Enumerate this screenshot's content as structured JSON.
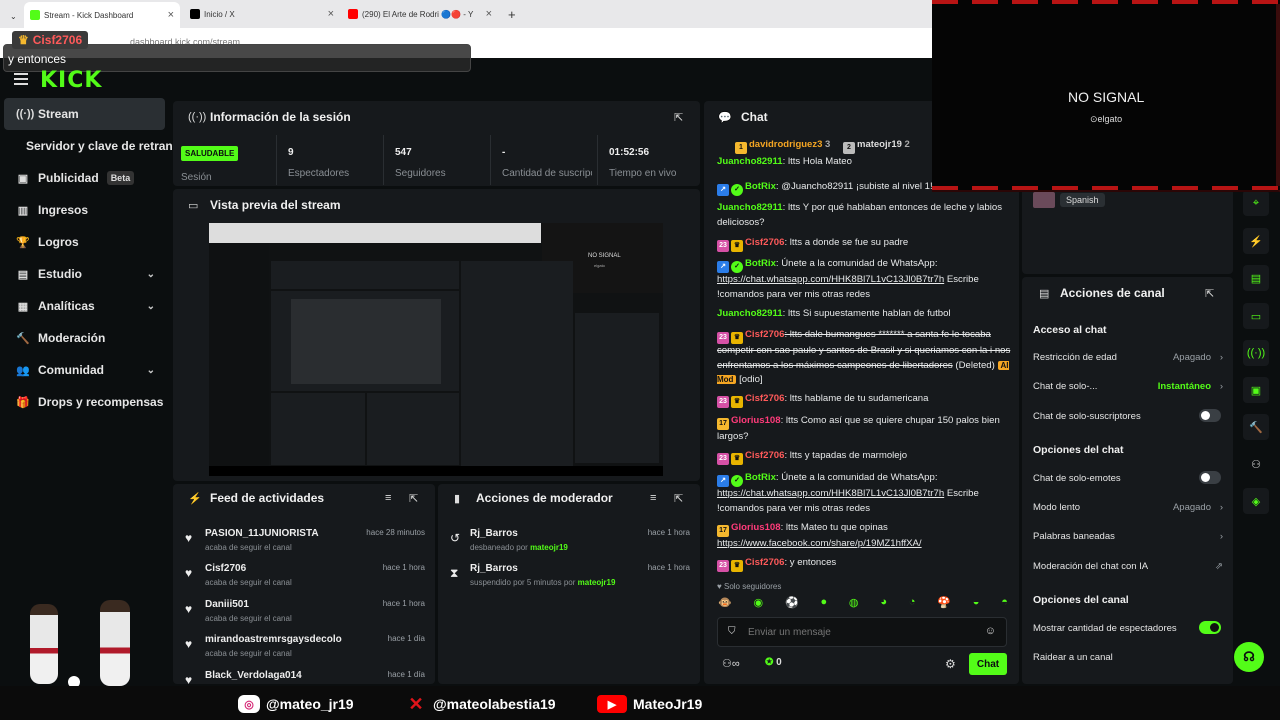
{
  "browser": {
    "tabs": [
      {
        "title": "Stream - Kick Dashboard"
      },
      {
        "title": "Inicio / X"
      },
      {
        "title": "(290) El Arte de Rodri 🔵🔴 - Y"
      }
    ],
    "new_tab": "+",
    "address": "dashboard.kick.com/stream"
  },
  "overlay": {
    "username": "Cisf2706",
    "message": "y entonces"
  },
  "app": {
    "logo": "KICK"
  },
  "sidebar": {
    "items": [
      {
        "label": "Stream",
        "icon": "stream-icon"
      },
      {
        "label": "Servidor y clave de retransmisión"
      },
      {
        "label": "Publicidad",
        "badge": "Beta"
      },
      {
        "label": "Ingresos"
      },
      {
        "label": "Logros"
      },
      {
        "label": "Estudio"
      },
      {
        "label": "Analíticas"
      },
      {
        "label": "Moderación"
      },
      {
        "label": "Comunidad"
      },
      {
        "label": "Drops y recompensas"
      }
    ]
  },
  "session": {
    "title": "Información de la sesión",
    "status": "SALUDABLE",
    "status_label": "Sesión",
    "stats": [
      {
        "value": "9",
        "label": "Espectadores"
      },
      {
        "value": "547",
        "label": "Seguidores"
      },
      {
        "value": "-",
        "label": "Cantidad de suscripciones"
      },
      {
        "value": "01:52:56",
        "label": "Tiempo en vivo"
      }
    ]
  },
  "preview": {
    "title": "Vista previa del stream",
    "no_signal": "NO SIGNAL",
    "elgato": "elgato"
  },
  "feed": {
    "title": "Feed de actividades",
    "items": [
      {
        "name": "PASION_11JUNIORISTA",
        "sub": "acaba de seguir el canal",
        "time": "hace 28 minutos"
      },
      {
        "name": "Cisf2706",
        "sub": "acaba de seguir el canal",
        "time": "hace 1 hora"
      },
      {
        "name": "Daniii501",
        "sub": "acaba de seguir el canal",
        "time": "hace 1 hora"
      },
      {
        "name": "mirandoastremrsgaysdecolo",
        "sub": "acaba de seguir el canal",
        "time": "hace 1 día"
      },
      {
        "name": "Black_Verdolaga014",
        "sub": "",
        "time": "hace 1 día"
      }
    ]
  },
  "modactions": {
    "title": "Acciones de moderador",
    "items": [
      {
        "name": "Rj_Barros",
        "sub": "desbaneado por",
        "by": "mateojr19",
        "time": "hace 1 hora"
      },
      {
        "name": "Rj_Barros",
        "sub": "suspendido por 5 minutos por",
        "by": "mateojr19",
        "time": "hace 1 hora"
      }
    ]
  },
  "chat": {
    "title": "Chat",
    "top_users": [
      {
        "name": "davidrodriguez3",
        "count": "3"
      },
      {
        "name": "mateojr19",
        "count": "2"
      }
    ],
    "messages": [
      {
        "user": "Juancho82911",
        "text": ": ltts Hola Mateo"
      },
      {
        "user": "BotRix",
        "text": ": @Juancho82911 ¡subiste al nivel 1!"
      },
      {
        "user": "Juancho82911",
        "text": ": ltts Y por qué hablaban entonces de leche y labios deliciosos?"
      },
      {
        "user": "Cisf2706",
        "text": ": ltts a donde se fue su padre",
        "badge": "23"
      },
      {
        "user": "BotRix",
        "text": ": Únete a la comunidad de WhatsApp:",
        "link": "https://chat.whatsapp.com/HHK8Bl7L1vC13Jl0B7tr7h",
        "tail": " Escribe !comandos para ver mis otras redes"
      },
      {
        "user": "Juancho82911",
        "text": ": ltts Si supuestamente hablan de futbol"
      },
      {
        "user": "Cisf2706",
        "text": ": ltts dale bumangues ******* a santa fe le tocaba competir con sao paulo y santos de Brasil y si queriamos con la i nos enfrentamos a los máximos campeones de libertadores",
        "deleted": "(Deleted)",
        "aimod": "AI Mod",
        "odio": "[odio]",
        "badge": "23"
      },
      {
        "user": "Cisf2706",
        "text": ": ltts hablame de tu sudamericana",
        "badge": "23"
      },
      {
        "user": "Glorius108",
        "text": ": ltts Como así que se quiere chupar 150 palos bien largos?",
        "badge": "17"
      },
      {
        "user": "Cisf2706",
        "text": ": ltts y tapadas de marmolejo",
        "badge": "23"
      },
      {
        "user": "BotRix",
        "text": ": Únete a la comunidad de WhatsApp:",
        "link": "https://chat.whatsapp.com/HHK8Bl7L1vC13Jl0B7tr7h",
        "tail": " Escribe !comandos para ver mis otras redes"
      },
      {
        "user": "Glorius108",
        "text": ": ltts Mateo tu que opinas",
        "link": "https://www.facebook.com/share/p/19MZ1hffXA/",
        "badge": "17"
      },
      {
        "user": "Cisf2706",
        "text": ": y entonces",
        "badge": "23"
      }
    ],
    "followers_only": "Solo seguidores",
    "input_placeholder": "Enviar un mensaje",
    "points": "0",
    "send_label": "Chat"
  },
  "stream_info": {
    "language": "Spanish"
  },
  "channel_actions": {
    "title": "Acciones de canal",
    "sections": [
      {
        "heading": "Acceso al chat",
        "rows": [
          {
            "label": "Restricción de edad",
            "value": "Apagado"
          },
          {
            "label": "Chat de solo-...",
            "value": "Instantáneo"
          },
          {
            "label": "Chat de solo-suscriptores"
          }
        ]
      },
      {
        "heading": "Opciones del chat",
        "rows": [
          {
            "label": "Chat de solo-emotes"
          },
          {
            "label": "Modo lento",
            "value": "Apagado"
          },
          {
            "label": "Palabras baneadas"
          },
          {
            "label": "Moderación del chat con IA"
          }
        ]
      },
      {
        "heading": "Opciones del canal",
        "rows": [
          {
            "label": "Mostrar cantidad de espectadores"
          },
          {
            "label": "Raidear a un canal"
          }
        ]
      }
    ]
  },
  "camera": {
    "no_signal": "NO SIGNAL",
    "brand": "elgato"
  },
  "socials": [
    {
      "handle": "@mateo_jr19",
      "icon": "instagram-icon"
    },
    {
      "handle": "@mateolabestia19",
      "icon": "x-icon"
    },
    {
      "handle": "MateoJr19",
      "icon": "youtube-icon"
    }
  ],
  "colors": {
    "accent": "#53fc18",
    "bg": "#0b0e0f",
    "panel": "#16191c"
  }
}
